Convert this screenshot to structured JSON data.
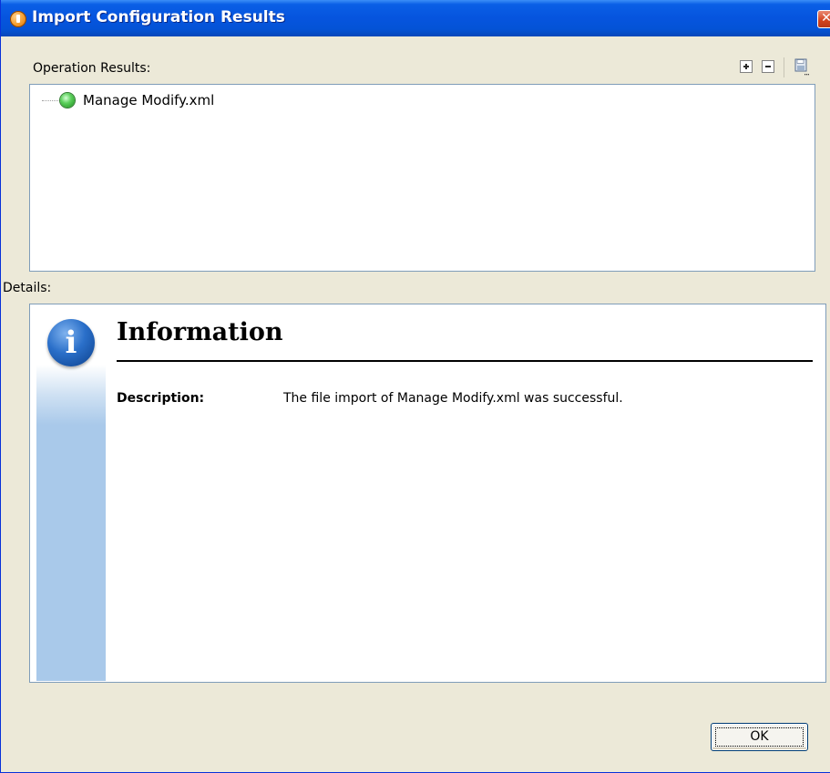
{
  "window": {
    "title": "Import Configuration Results",
    "close_glyph": "✕"
  },
  "operation_results": {
    "label": "Operation Results:",
    "toolbar": {
      "expand_icon": "expand-all-icon",
      "collapse_icon": "collapse-all-icon",
      "save_icon": "save-as-icon"
    },
    "tree": [
      {
        "label": "Manage Modify.xml",
        "status": "success",
        "status_color": "#3cb83c"
      }
    ]
  },
  "details": {
    "label": "Details:",
    "icon_glyph": "i",
    "heading": "Information",
    "description_label": "Description:",
    "description_text": "The file import of Manage Modify.xml was successful."
  },
  "buttons": {
    "ok_label": "OK"
  },
  "colors": {
    "titlebar": "#0654de",
    "dialog_bg": "#ece9d8",
    "panel_border": "#7f9db9",
    "stripe": "#a9c9ea"
  }
}
